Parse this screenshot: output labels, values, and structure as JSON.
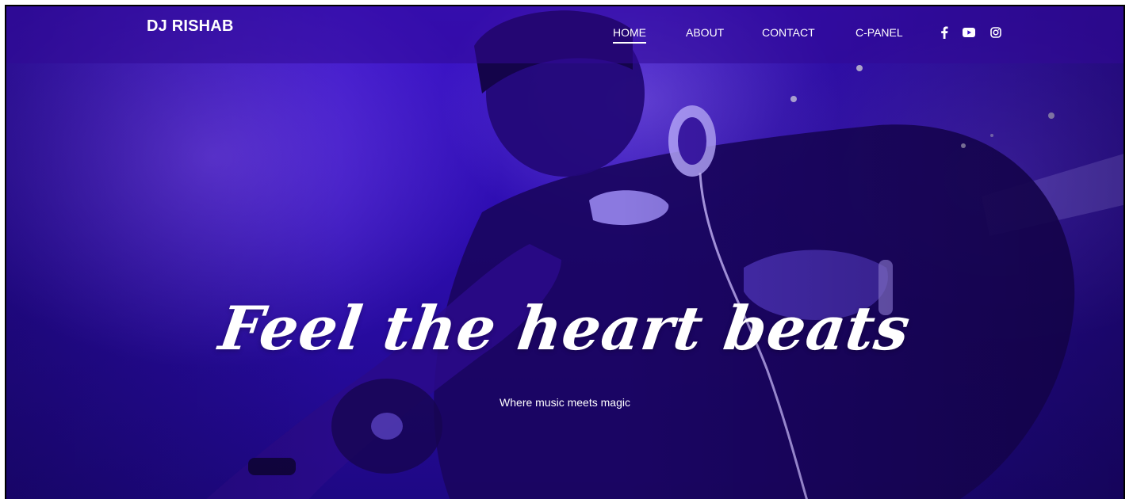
{
  "brand": "DJ RISHAB",
  "nav": {
    "home": "HOME",
    "about": "ABOUT",
    "contact": "CONTACT",
    "cpanel": "C-PANEL"
  },
  "social": [
    "facebook-icon",
    "youtube-icon",
    "instagram-icon"
  ],
  "hero": {
    "headline": "Feel the heart beats",
    "subtitle": "Where music meets magic"
  },
  "colors": {
    "hero_purple": "#3a12c8",
    "nav_overlay": "#320a96",
    "text": "#ffffff"
  }
}
